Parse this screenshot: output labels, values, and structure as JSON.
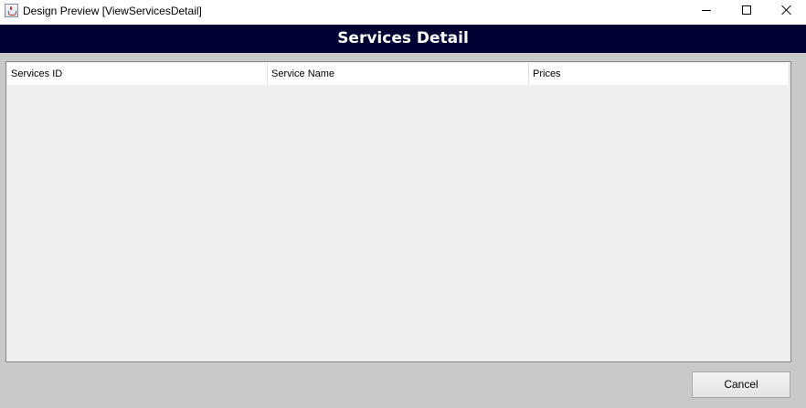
{
  "window": {
    "title": "Design Preview [ViewServicesDetail]",
    "icon": "java-cup-icon",
    "controls": [
      "minimize-icon",
      "maximize-icon",
      "close-icon"
    ]
  },
  "header": {
    "title": "Services Detail",
    "background": "#000033",
    "text_color": "#ffffff"
  },
  "table": {
    "columns": [
      "Services ID",
      "Service Name",
      "Prices"
    ],
    "rows": []
  },
  "footer": {
    "cancel_label": "Cancel"
  }
}
